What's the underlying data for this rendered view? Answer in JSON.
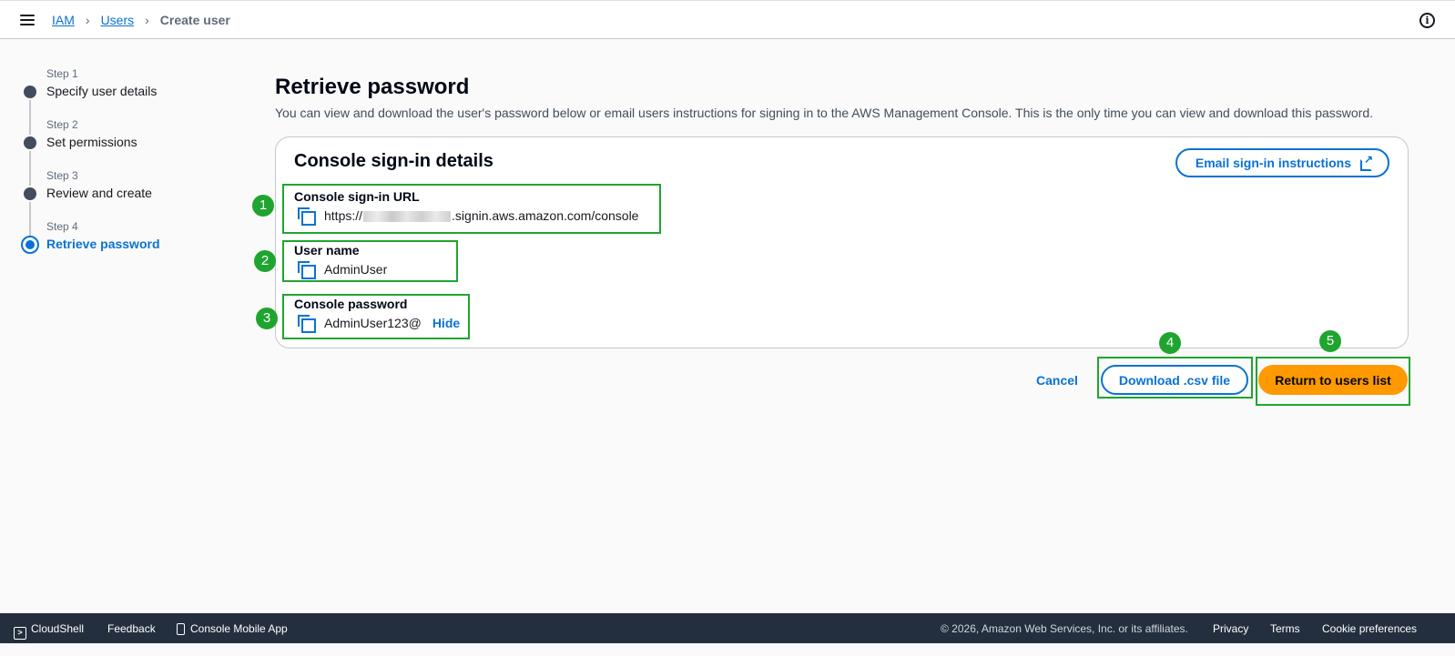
{
  "header": {
    "breadcrumbs": [
      "IAM",
      "Users",
      "Create user"
    ],
    "separator": ">"
  },
  "steps": [
    {
      "num": "Step 1",
      "label": "Specify user details",
      "state": "done"
    },
    {
      "num": "Step 2",
      "label": "Set permissions",
      "state": "done"
    },
    {
      "num": "Step 3",
      "label": "Review and create",
      "state": "done"
    },
    {
      "num": "Step 4",
      "label": "Retrieve password",
      "state": "active"
    }
  ],
  "main": {
    "title": "Retrieve password",
    "description": "You can view and download the user's password below or email users instructions for signing in to the AWS Management Console. This is the only time you can view and download this password."
  },
  "card": {
    "title": "Console sign-in details",
    "email_button": "Email sign-in instructions",
    "fields": {
      "url_label": "Console sign-in URL",
      "url_prefix": "https://",
      "url_suffix": ".signin.aws.amazon.com/console",
      "username_label": "User name",
      "username_value": "AdminUser",
      "password_label": "Console password",
      "password_value": "AdminUser123@",
      "hide_link": "Hide"
    }
  },
  "annotations": [
    "1",
    "2",
    "3",
    "4",
    "5"
  ],
  "actions": {
    "cancel": "Cancel",
    "download": "Download .csv file",
    "return": "Return to users list"
  },
  "footer": {
    "cloudshell": "CloudShell",
    "feedback": "Feedback",
    "mobile_app": "Console Mobile App",
    "copyright": "© 2026, Amazon Web Services, Inc. or its affiliates.",
    "privacy": "Privacy",
    "terms": "Terms",
    "cookies": "Cookie preferences"
  },
  "colors": {
    "accent": "#0972d3",
    "primary_button": "#ff9900",
    "annotation": "#1fa52f",
    "footer_bg": "#232f3e"
  }
}
